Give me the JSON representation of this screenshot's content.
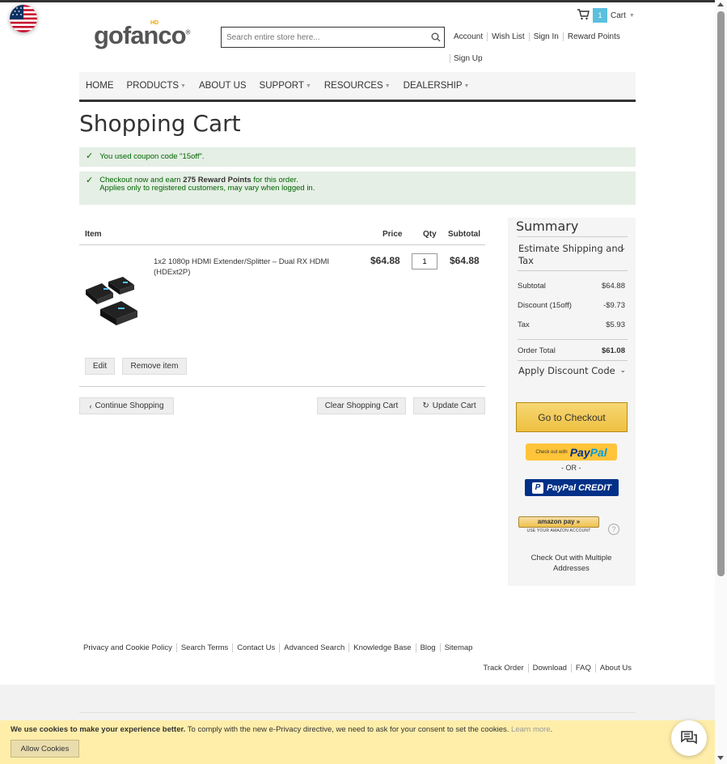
{
  "header": {
    "logo_text": "gofanco",
    "logo_mark": "®",
    "logo_badge": "HD",
    "search_placeholder": "Search entire store here...",
    "cart_count": "1",
    "cart_label": "Cart",
    "links": [
      "Account",
      "Wish List",
      "Sign In",
      "Reward Points"
    ],
    "signup": "Sign Up"
  },
  "nav": {
    "items": [
      {
        "label": "HOME",
        "has_dropdown": false
      },
      {
        "label": "PRODUCTS",
        "has_dropdown": true
      },
      {
        "label": "ABOUT US",
        "has_dropdown": false
      },
      {
        "label": "SUPPORT",
        "has_dropdown": true
      },
      {
        "label": "RESOURCES",
        "has_dropdown": true
      },
      {
        "label": "DEALERSHIP",
        "has_dropdown": true
      }
    ]
  },
  "page": {
    "title": "Shopping Cart",
    "coupon_msg": "You used coupon code \"15off\".",
    "reward_msg_pre": "Checkout now and earn ",
    "reward_points": "275 Reward Points",
    "reward_msg_post": " for this order.",
    "reward_msg_line2": "Applies only to registered customers, may vary when logged in."
  },
  "cart": {
    "headers": {
      "item": "Item",
      "price": "Price",
      "qty": "Qty",
      "subtotal": "Subtotal"
    },
    "items": [
      {
        "name": "1x2 1080p HDMI Extender/Splitter – Dual RX HDMI (HDExt2P)",
        "price": "$64.88",
        "qty": "1",
        "subtotal": "$64.88"
      }
    ],
    "edit_label": "Edit",
    "remove_label": "Remove item",
    "continue_label": "Continue Shopping",
    "clear_label": "Clear Shopping Cart",
    "update_label": "Update Cart"
  },
  "summary": {
    "title": "Summary",
    "shipping_label": "Estimate Shipping and Tax",
    "rows": [
      {
        "label": "Subtotal",
        "value": "$64.88"
      },
      {
        "label": "Discount (15off)",
        "value": "-$9.73"
      },
      {
        "label": "Tax",
        "value": "$5.93"
      }
    ],
    "order_total_label": "Order Total",
    "order_total_value": "$61.08",
    "discount_label": "Apply Discount Code",
    "checkout_label": "Go to Checkout",
    "paypal_small": "Check out with",
    "paypal_brand_a": "Pay",
    "paypal_brand_b": "Pal",
    "or_label": "- OR -",
    "paypal_credit": "PayPal CREDIT",
    "amazon_label": "amazon pay",
    "amazon_sub": "USE YOUR AMAZON ACCOUNT",
    "help_glyph": "?",
    "multi_label": "Check Out with Multiple Addresses"
  },
  "footer": {
    "links1": [
      "Privacy and Cookie Policy",
      "Search Terms",
      "Contact Us",
      "Advanced Search",
      "Knowledge Base",
      "Blog",
      "Sitemap"
    ],
    "links2": [
      "Track Order",
      "Download",
      "FAQ",
      "About Us"
    ]
  },
  "cookie": {
    "bold": "We use cookies to make your experience better.",
    "text": " To comply with the new e-Privacy directive, we need to ask for your consent to set the cookies. ",
    "learn": "Learn more",
    "allow_label": "Allow Cookies"
  },
  "icons": {
    "flag": "us-flag-icon",
    "search": "search-icon",
    "cart": "cart-icon",
    "chat": "chat-icon"
  },
  "colors": {
    "success_bg": "#e5efe5",
    "success_text": "#006400",
    "checkout_btn": "#f0c14b",
    "paypal_yellow": "#ffc439",
    "paypal_blue": "#003087",
    "cookie_bar": "#ffeeaa",
    "cart_badge": "#5bc0de"
  }
}
